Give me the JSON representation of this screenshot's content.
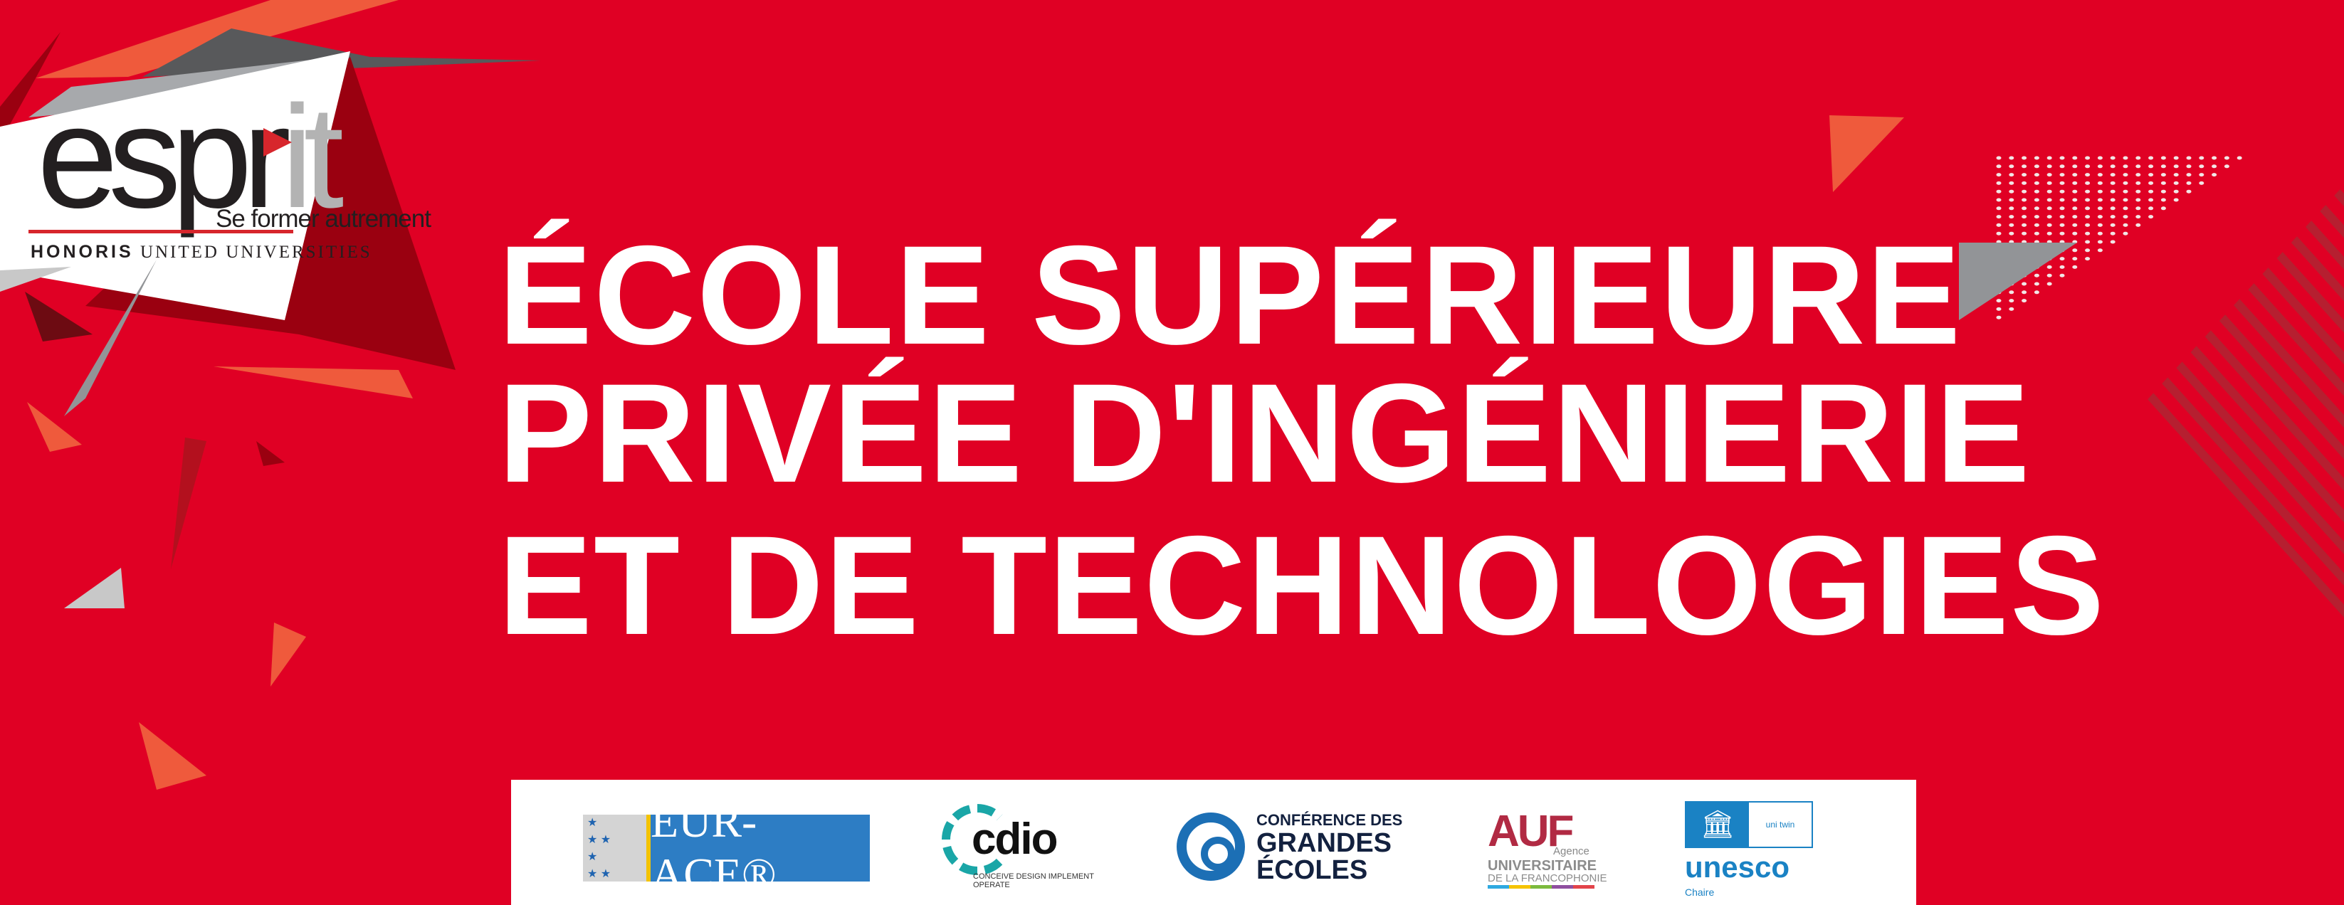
{
  "colors": {
    "background": "#e00024",
    "dark_red": "#9a0010",
    "orange": "#ef5a3c",
    "gray": "#929497",
    "light_gray": "#b3b3b3",
    "stripe": "#b61f30"
  },
  "logo": {
    "word_main": "espr",
    "word_accent": "it",
    "tagline": "Se former autrement",
    "network_bold": "HONORIS",
    "network_rest": "UNITED UNIVERSITIES"
  },
  "title_lines": [
    "ÉCOLE SUPÉRIEURE",
    "PRIVÉE D'INGÉNIERIE",
    "ET DE TECHNOLOGIES"
  ],
  "partners": {
    "eur_ace": {
      "label": "EUR-ACE®"
    },
    "cdio": {
      "label": "cdio",
      "subtitle": "CONCEIVE DESIGN IMPLEMENT OPERATE"
    },
    "cge": {
      "line1": "CONFÉRENCE DES",
      "line2": "GRANDES",
      "line3": "ÉCOLES"
    },
    "auf": {
      "acronym": "AUF",
      "agence": "Agence",
      "line1": "UNIVERSITAIRE",
      "line2": "DE LA FRANCOPHONIE"
    },
    "unesco": {
      "side": "uni twin",
      "label": "unesco",
      "chaire": "Chaire"
    }
  }
}
